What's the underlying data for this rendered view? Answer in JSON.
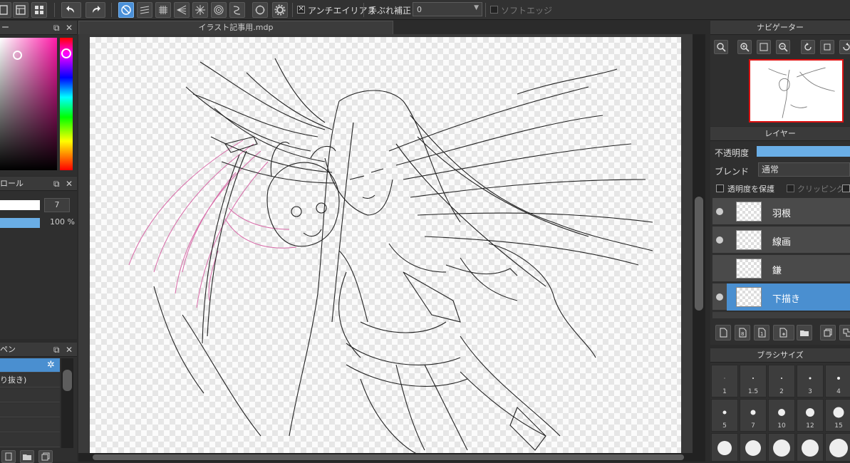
{
  "toolbar": {
    "antialias_label": "アンチエイリアス",
    "stabilizer_label": "手ぶれ補正",
    "stabilizer_value": "0",
    "soft_edge_label": "ソフトエッジ"
  },
  "document": {
    "tab_title": "イラスト記事用.mdp"
  },
  "left_panels": {
    "color_title": "ー",
    "brush_control_title": "ロール",
    "brush_size_value": "7",
    "opacity_value": "100 %",
    "brush_list_title": "ペン",
    "brush_items": [
      "り抜き)"
    ]
  },
  "navigator": {
    "title": "ナビゲーター"
  },
  "layers": {
    "title": "レイヤー",
    "opacity_label": "不透明度",
    "blend_label": "ブレンド",
    "blend_value": "通常",
    "protect_alpha_label": "透明度を保護",
    "clipping_label": "クリッピング",
    "items": [
      {
        "name": "羽根",
        "visible": true,
        "selected": false
      },
      {
        "name": "線画",
        "visible": true,
        "selected": false
      },
      {
        "name": "鎌",
        "visible": false,
        "selected": false
      },
      {
        "name": "下描き",
        "visible": true,
        "selected": true
      }
    ]
  },
  "brush_size_panel": {
    "title": "ブラシサイズ",
    "sizes": [
      "1",
      "1.5",
      "2",
      "3",
      "4",
      "5",
      "7",
      "10",
      "12",
      "15"
    ]
  },
  "colors": {
    "accent": "#4a90d9",
    "selected_layer": "#4a8fd0",
    "sketch_pink": "#d86aa8"
  }
}
